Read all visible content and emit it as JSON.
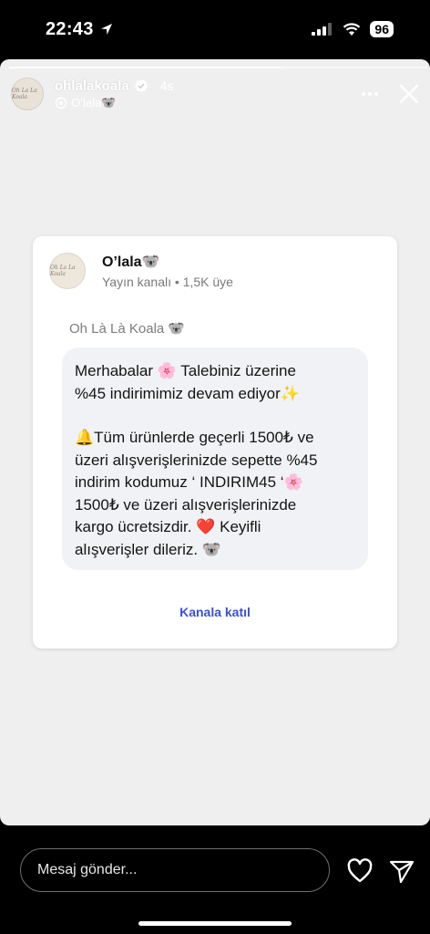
{
  "status_bar": {
    "time": "22:43",
    "battery": "96"
  },
  "story": {
    "progress": 0.65,
    "username": "ohlalakoala",
    "age": "4s",
    "channel_label": "O’lala🐨",
    "avatar_text": "Oh La La Koala"
  },
  "card": {
    "channel_name": "O’lala🐨",
    "channel_meta": "Yayın kanalı  •  1,5K üye",
    "sender": "Oh Là Là Koala 🐨",
    "message_p1": "Merhabalar 🌸 Talebiniz üzerine\n%45 indirimimiz devam ediyor✨",
    "message_p2": "🔔Tüm ürünlerde geçerli 1500₺ ve\nüzeri alışverişlerinizde sepette %45\nindirim kodumuz ‘ INDIRIM45 ‘🌸\n1500₺ ve üzeri alışverişlerinizde\nkargo ücretsizdir. ❤️ Keyifli\nalışverişler dileriz. 🐨",
    "join_label": "Kanala katıl"
  },
  "bottom_bar": {
    "reply_placeholder": "Mesaj gönder..."
  },
  "colors": {
    "story_bg": "#efefef",
    "join_link": "#3b51d1",
    "bubble_bg": "#f0f2f5"
  }
}
